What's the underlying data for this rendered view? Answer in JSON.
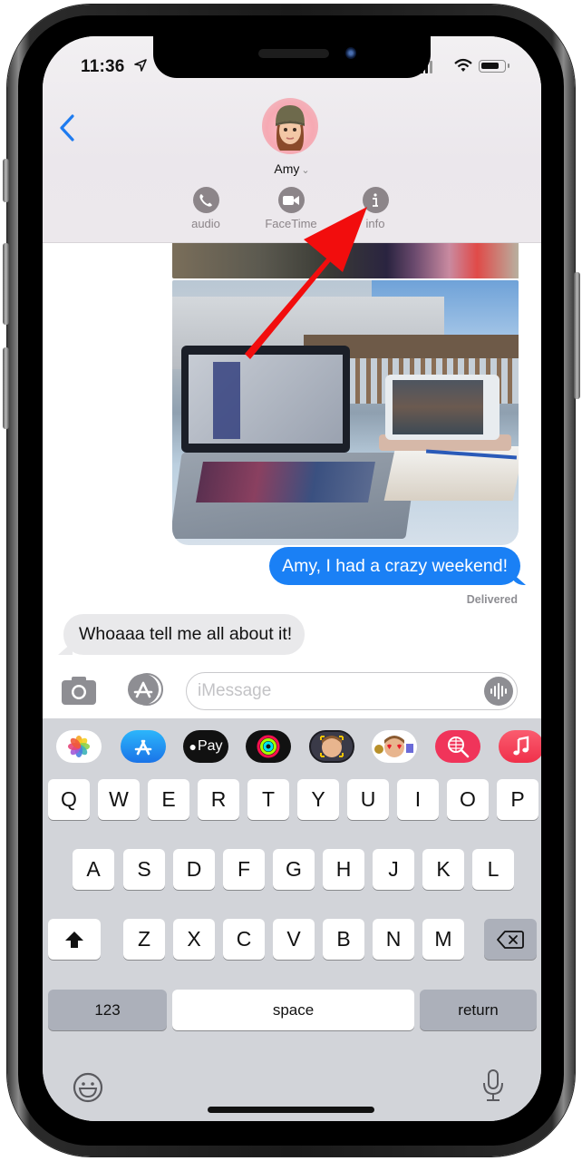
{
  "status_bar": {
    "time": "11:36",
    "location_icon": "location-arrow-icon",
    "signal_icon": "cellular-signal-icon",
    "wifi_icon": "wifi-icon",
    "battery_icon": "battery-icon"
  },
  "header": {
    "back_icon": "chevron-left-icon",
    "contact_name": "Amy",
    "contact_chevron": "⌄",
    "avatar_icon": "memoji-avatar",
    "actions": [
      {
        "label": "audio",
        "icon": "phone-icon"
      },
      {
        "label": "FaceTime",
        "icon": "video-camera-icon"
      },
      {
        "label": "info",
        "icon": "info-icon"
      }
    ]
  },
  "conversation": {
    "messages": [
      {
        "type": "image",
        "direction": "sent",
        "description": "photo-partial-flowers"
      },
      {
        "type": "image",
        "direction": "sent",
        "description": "photo-laptop-and-tablet-outdoors"
      },
      {
        "type": "text",
        "direction": "sent",
        "text": "Amy, I had a crazy weekend!"
      },
      {
        "type": "text",
        "direction": "received",
        "text": "Whoaaa tell me all about it!"
      }
    ],
    "delivery_status": "Delivered"
  },
  "composer": {
    "camera_icon": "camera-icon",
    "apps_icon": "app-store-icon",
    "placeholder": "iMessage",
    "audio_icon": "audio-waveform-icon"
  },
  "app_strip": [
    {
      "name": "Photos",
      "icon": "photos-icon"
    },
    {
      "name": "App Store",
      "icon": "app-store-icon"
    },
    {
      "name": "Apple Pay",
      "icon": "apple-pay-icon",
      "label": "Pay"
    },
    {
      "name": "Activity",
      "icon": "activity-rings-icon"
    },
    {
      "name": "Memoji Stickers",
      "icon": "memoji-camera-icon"
    },
    {
      "name": "Memoji",
      "icon": "memoji-stickers-icon"
    },
    {
      "name": "Images Search",
      "icon": "globe-search-icon"
    },
    {
      "name": "Music",
      "icon": "music-note-icon"
    }
  ],
  "keyboard": {
    "row1": [
      "Q",
      "W",
      "E",
      "R",
      "T",
      "Y",
      "U",
      "I",
      "O",
      "P"
    ],
    "row2": [
      "A",
      "S",
      "D",
      "F",
      "G",
      "H",
      "J",
      "K",
      "L"
    ],
    "row3": [
      "Z",
      "X",
      "C",
      "V",
      "B",
      "N",
      "M"
    ],
    "shift_icon": "shift-arrow-icon",
    "delete_icon": "backspace-icon",
    "numbers_label": "123",
    "space_label": "space",
    "return_label": "return",
    "emoji_icon": "emoji-icon",
    "dictation_icon": "microphone-icon"
  },
  "annotation": {
    "icon": "red-arrow-pointer",
    "color": "#f20d0d",
    "target": "info"
  },
  "colors": {
    "imessage_blue": "#1a80f5",
    "received_bubble": "#e9e9eb",
    "ios_link_blue": "#1e7bf0",
    "action_gray": "#8c8589",
    "keyboard_bg": "#d2d4d9"
  }
}
